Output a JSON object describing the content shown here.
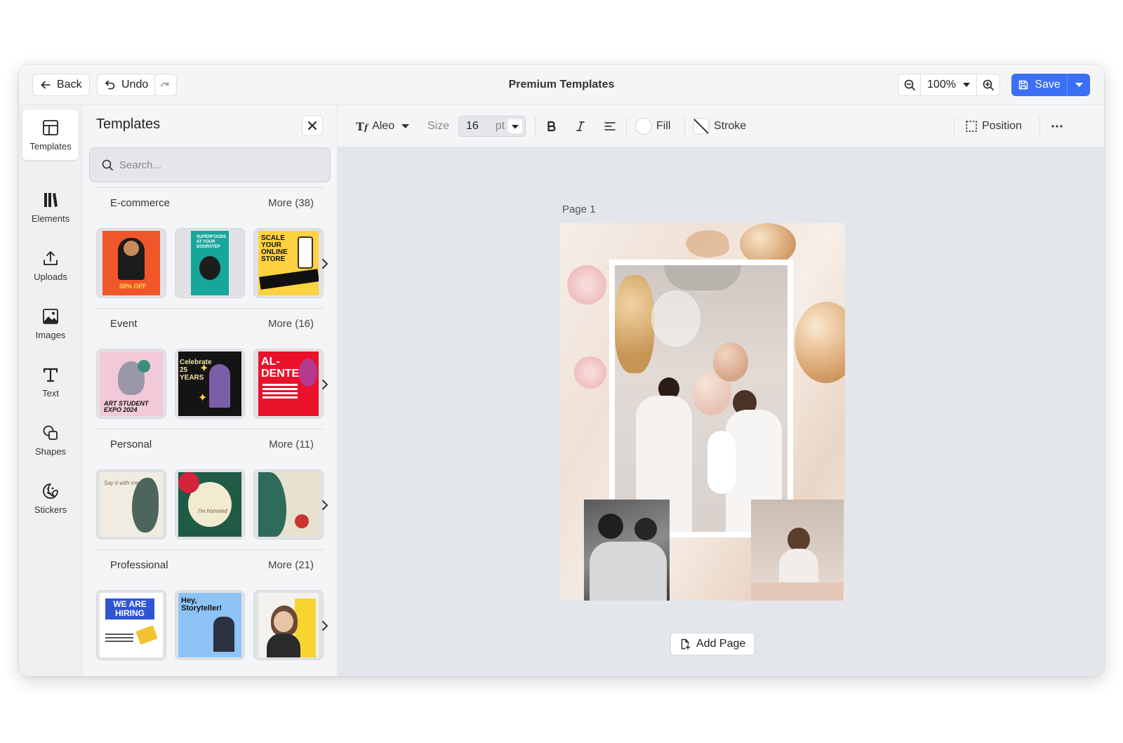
{
  "topbar": {
    "back_label": "Back",
    "undo_label": "Undo",
    "title": "Premium Templates",
    "zoom_value": "100%",
    "save_label": "Save"
  },
  "rail": {
    "items": [
      {
        "label": "Templates",
        "icon": "templates-icon",
        "active": true
      },
      {
        "label": "Elements",
        "icon": "elements-icon"
      },
      {
        "label": "Uploads",
        "icon": "upload-icon"
      },
      {
        "label": "Images",
        "icon": "image-icon"
      },
      {
        "label": "Text",
        "icon": "text-icon"
      },
      {
        "label": "Shapes",
        "icon": "shapes-icon"
      },
      {
        "label": "Stickers",
        "icon": "sticker-icon"
      }
    ]
  },
  "panel": {
    "title": "Templates",
    "search_placeholder": "Search...",
    "categories": [
      {
        "name": "E-commerce",
        "more": "More (38)",
        "thumbs": [
          "50% OFF",
          "SUPERFOODS AT YOUR DOORSTEP",
          "SCALE YOUR ONLINE STORE"
        ]
      },
      {
        "name": "Event",
        "more": "More (16)",
        "thumbs": [
          "ART STUDENT EXPO 2024",
          "Celebrate 25 YEARS",
          "AL-DENTE"
        ]
      },
      {
        "name": "Personal",
        "more": "More (11)",
        "thumbs": [
          "Say it with me",
          "I'm honored",
          ""
        ]
      },
      {
        "name": "Professional",
        "more": "More (21)",
        "thumbs": [
          "WE ARE HIRING",
          "Hey, Storyteller!",
          ""
        ]
      }
    ]
  },
  "toolbar": {
    "font_name": "Aleo",
    "size_label": "Size",
    "size_value": "16",
    "size_unit": "pt",
    "fill_label": "Fill",
    "stroke_label": "Stroke",
    "position_label": "Position"
  },
  "canvas": {
    "page_label": "Page  1",
    "add_page_label": "Add Page"
  },
  "colors": {
    "accent": "#3b6ff5",
    "panel_bg": "#f4f5f6",
    "canvas_bg": "#e3e6ea"
  }
}
